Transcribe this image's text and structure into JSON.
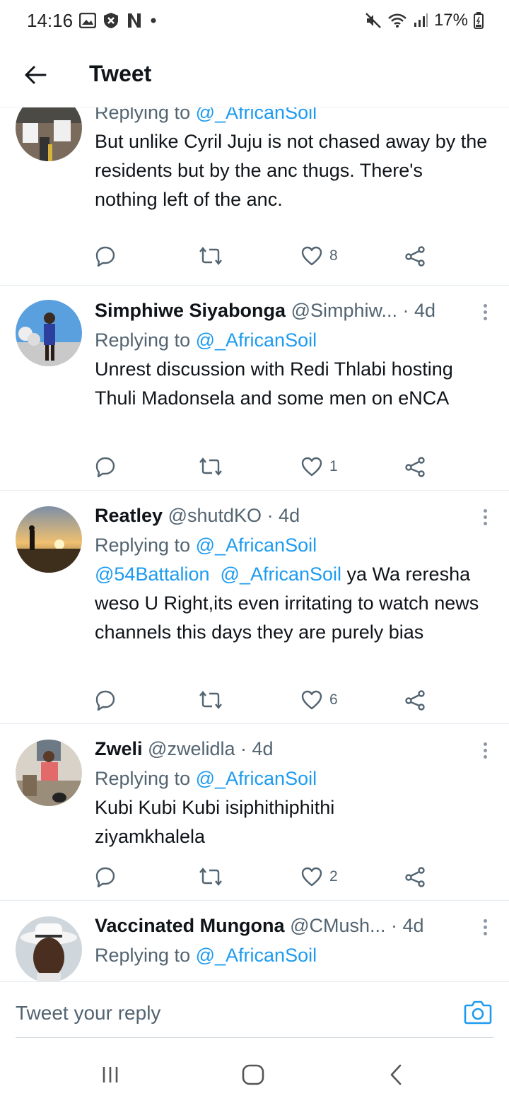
{
  "status_bar": {
    "time": "14:16",
    "battery": "17%"
  },
  "header": {
    "title": "Tweet"
  },
  "tweets": [
    {
      "name": "",
      "handle": "",
      "time": "",
      "replying_prefix": "Replying to",
      "replying_to": "@_AfricanSoil",
      "text": "But unlike Cyril Juju is not chased away by the residents but by the anc thugs. There's nothing left of the anc.",
      "likes": "8"
    },
    {
      "name": "Simphiwe Siyabonga",
      "handle": "@Simphiw...",
      "time": "· 4d",
      "replying_prefix": "Replying to",
      "replying_to": "@_AfricanSoil",
      "text": "Unrest discussion with Redi Thlabi hosting Thuli Madonsela and some men on eNCA",
      "likes": "1"
    },
    {
      "name": "Reatley",
      "handle": "@shutdKO",
      "time": "· 4d",
      "replying_prefix": "Replying to",
      "replying_to": "@_AfricanSoil",
      "mention1": "@54Battalion",
      "mention2": "@_AfricanSoil",
      "text": "ya Wa reresha weso U Right,its even irritating to watch news channels this days they are purely bias",
      "likes": "6"
    },
    {
      "name": "Zweli",
      "handle": "@zwelidla",
      "time": "· 4d",
      "replying_prefix": "Replying to",
      "replying_to": "@_AfricanSoil",
      "text": "Kubi Kubi Kubi isiphithiphithi ziyamkhalela",
      "likes": "2"
    },
    {
      "name": "Vaccinated Mungona",
      "handle": "@CMush...",
      "time": "· 4d",
      "replying_prefix": "Replying to",
      "replying_to": "@_AfricanSoil"
    }
  ],
  "reply_bar": {
    "placeholder": "Tweet your reply"
  },
  "icons": {
    "accent": "#1d9bf0",
    "names": [
      "back-arrow-icon",
      "reply-icon",
      "retweet-icon",
      "like-icon",
      "share-icon",
      "camera-icon",
      "more-icon"
    ]
  }
}
